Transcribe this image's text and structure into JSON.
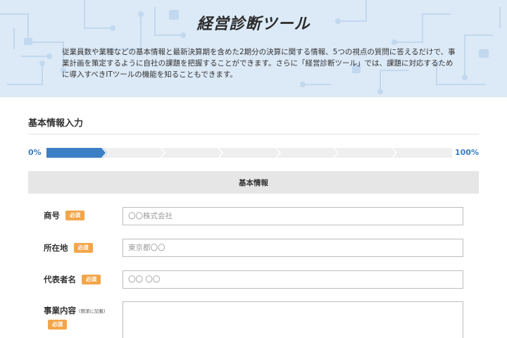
{
  "hero": {
    "title": "経営診断ツール",
    "description": "従業員数や業種などの基本情報と最新決算期を含めた2期分の決算に関する情報、5つの視点の質問に答えるだけで、事業計画を策定するように自社の課題を把握することができます。さらに「経営診断ツール」では、課題に対応するために導入すべきITツールの機能を知ることもできます。"
  },
  "section": {
    "title": "基本情報入力"
  },
  "progress": {
    "start_label": "0%",
    "end_label": "100%",
    "value": 0.15,
    "steps": 7
  },
  "band": {
    "label": "基本情報"
  },
  "form": {
    "required_label": "必須",
    "trade_name": {
      "label": "商号",
      "placeholder": "〇〇株式会社"
    },
    "location": {
      "label": "所在地",
      "placeholder": "東京都〇〇"
    },
    "representative": {
      "label": "代表者名",
      "placeholder": "〇〇 〇〇"
    },
    "business": {
      "label": "事業内容",
      "note": "(簡潔に記載)"
    }
  },
  "colors": {
    "accent": "#3d7fc4",
    "required_badge": "#f2a64a",
    "hero_bg": "#dce9f6"
  }
}
